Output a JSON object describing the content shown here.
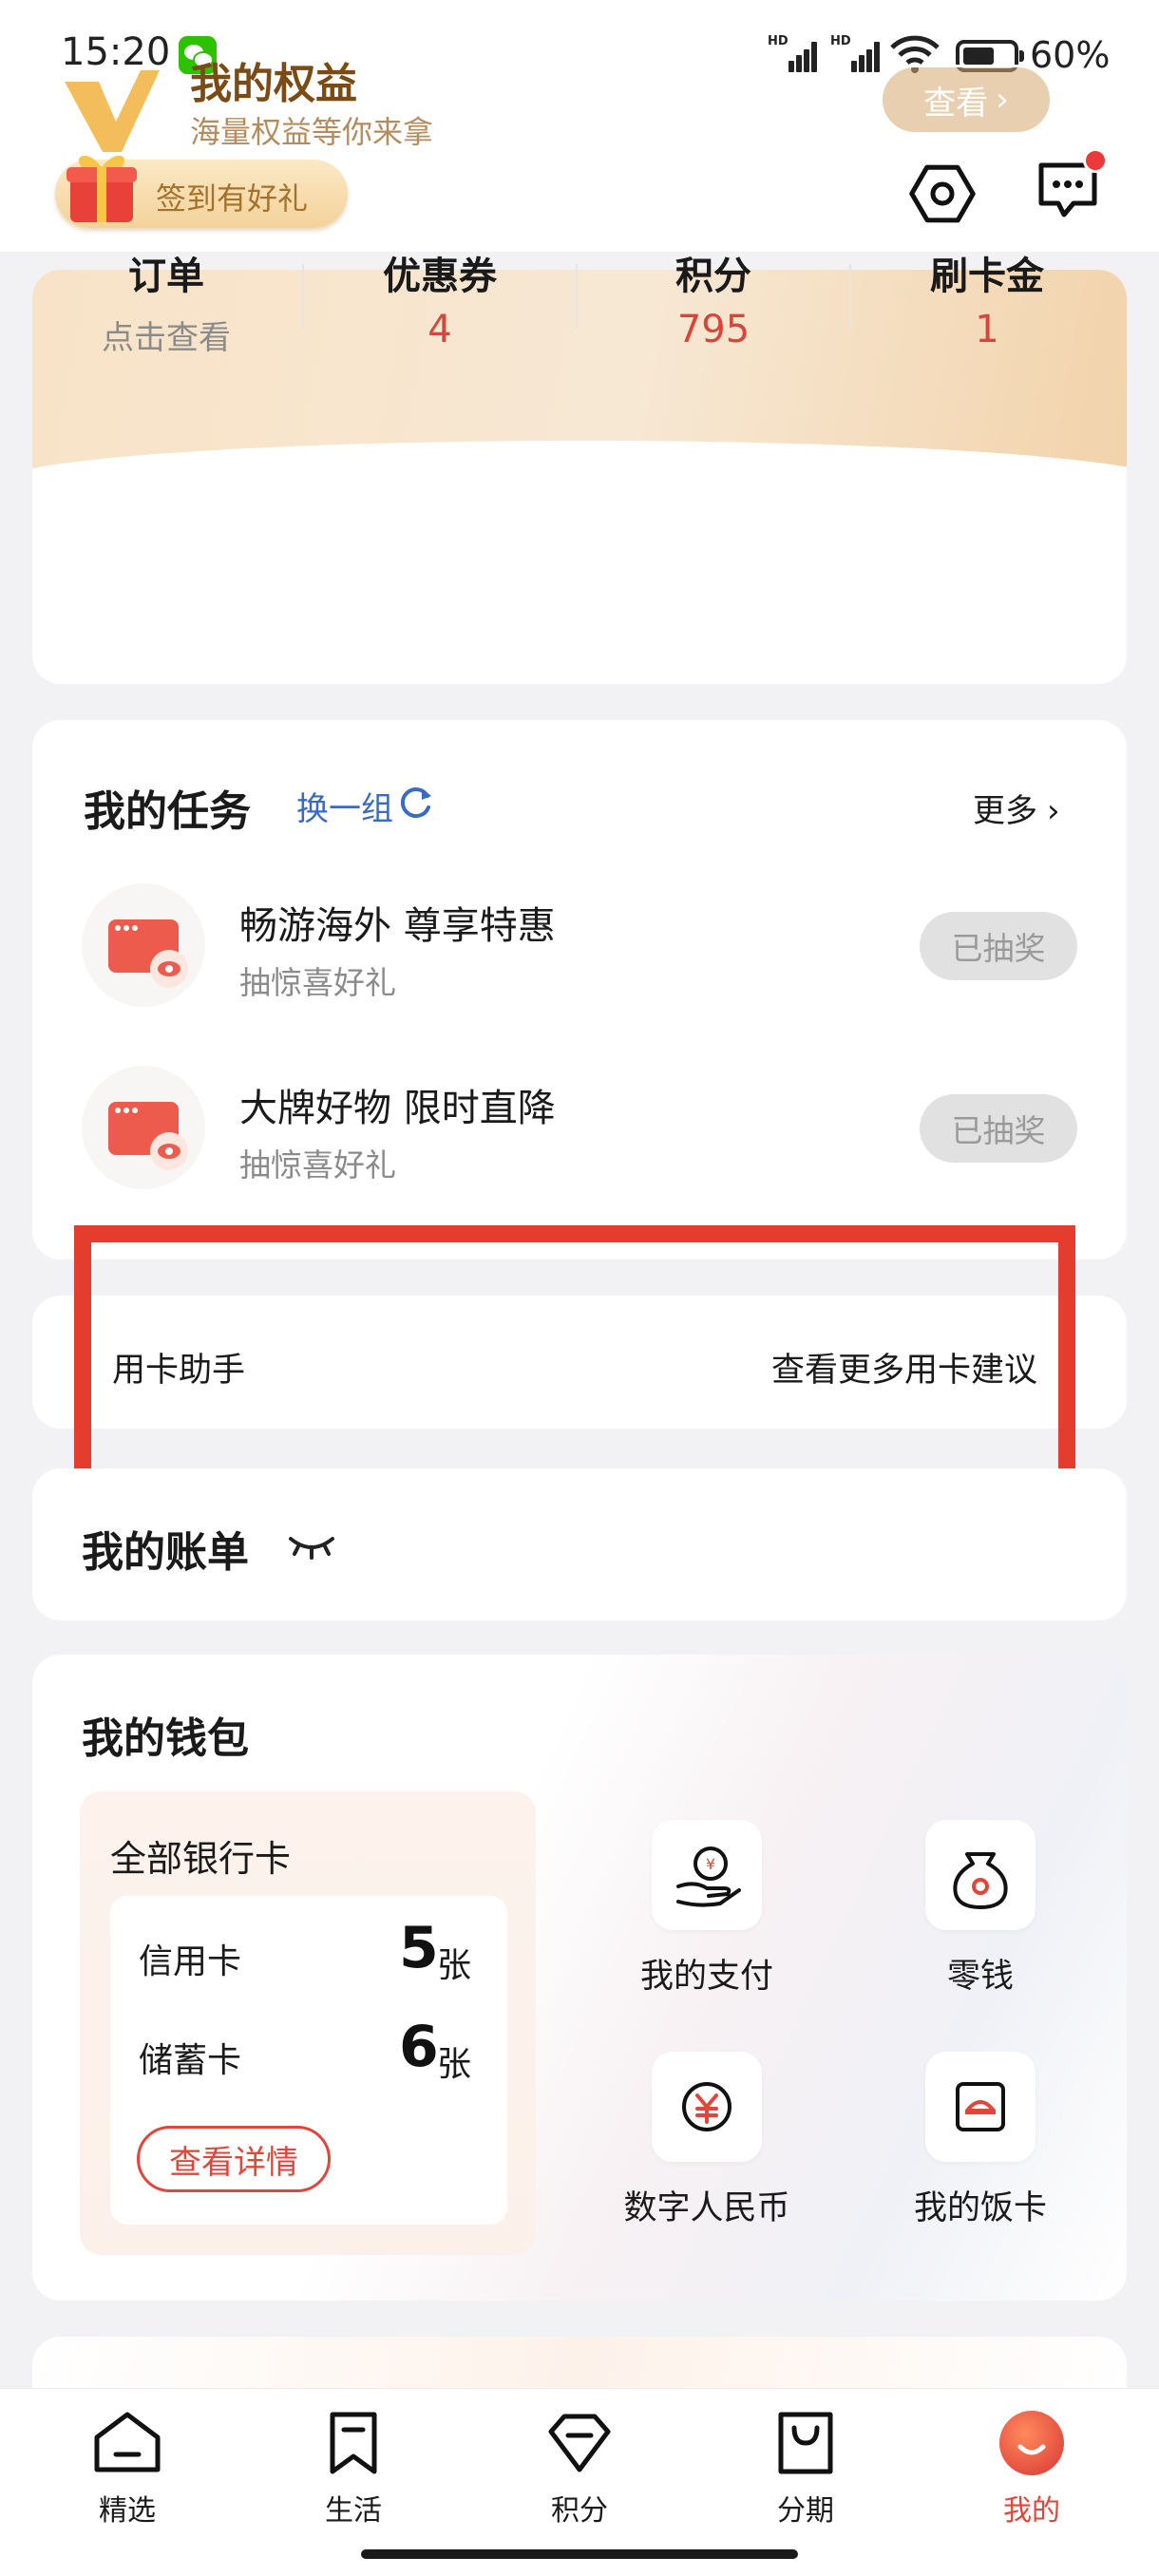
{
  "status_bar": {
    "time": "15:20",
    "battery": "60%",
    "sim1": "HD",
    "sim2": "HD"
  },
  "header": {
    "signin_label": "签到有好礼"
  },
  "benefits": {
    "title": "我的权益",
    "subtitle": "海量权益等你来拿",
    "view_button": "查看",
    "stats": [
      {
        "label": "订单",
        "value": "点击查看"
      },
      {
        "label": "优惠券",
        "value": "4"
      },
      {
        "label": "积分",
        "value": "795"
      },
      {
        "label": "刷卡金",
        "value": "1"
      }
    ]
  },
  "tasks": {
    "title": "我的任务",
    "refresh_label": "换一组",
    "more_label": "更多",
    "items": [
      {
        "title": "畅游海外 尊享特惠",
        "subtitle": "抽惊喜好礼",
        "button": "已抽奖"
      },
      {
        "title": "大牌好物 限时直降",
        "subtitle": "抽惊喜好礼",
        "button": "已抽奖"
      }
    ]
  },
  "assistant": {
    "label": "用卡助手",
    "link": "查看更多用卡建议"
  },
  "bill": {
    "title": "我的账单"
  },
  "wallet": {
    "title": "我的钱包",
    "all_cards_title": "全部银行卡",
    "cards": [
      {
        "label": "信用卡",
        "count": "5",
        "unit": "张"
      },
      {
        "label": "储蓄卡",
        "count": "6",
        "unit": "张"
      }
    ],
    "detail_button": "查看详情",
    "shortcuts": [
      {
        "label": "我的支付",
        "icon": "payment-hand-icon"
      },
      {
        "label": "零钱",
        "icon": "money-bag-icon"
      },
      {
        "label": "数字人民币",
        "icon": "digital-yuan-icon"
      },
      {
        "label": "我的饭卡",
        "icon": "meal-card-icon"
      }
    ]
  },
  "bottom_nav": [
    {
      "label": "精选",
      "icon": "home-icon"
    },
    {
      "label": "生活",
      "icon": "bookmark-icon"
    },
    {
      "label": "积分",
      "icon": "diamond-icon"
    },
    {
      "label": "分期",
      "icon": "shopping-bag-icon"
    },
    {
      "label": "我的",
      "icon": "profile-smile-icon",
      "active": true
    }
  ],
  "colors": {
    "accent": "#e0473c",
    "link_blue": "#3a6bc4",
    "gold": "#7a4b15",
    "highlight": "#e43d2d"
  }
}
